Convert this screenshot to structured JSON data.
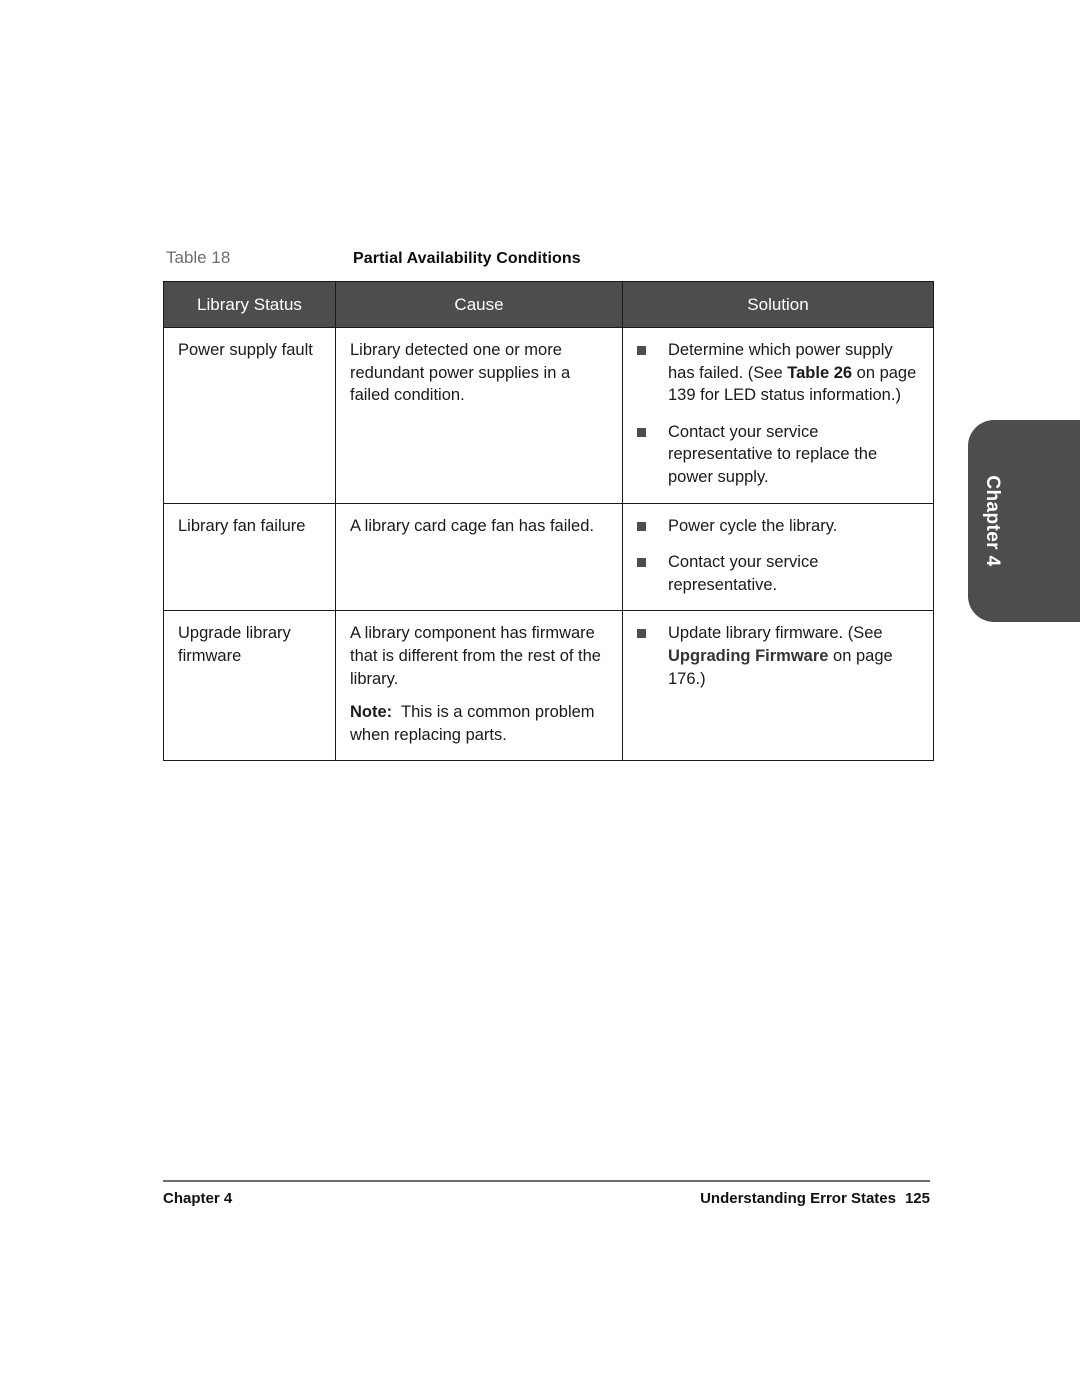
{
  "caption": {
    "label": "Table 18",
    "title": "Partial Availability Conditions"
  },
  "table": {
    "headers": {
      "status": "Library Status",
      "cause": "Cause",
      "solution": "Solution"
    },
    "rows": [
      {
        "status": "Power supply fault",
        "cause": "Library detected one or more redundant power supplies in a failed condition.",
        "solution": [
          {
            "prefix": "Determine which power supply has failed. (See ",
            "bold": "Table 26",
            "suffix": " on page 139 for LED status information.)"
          },
          {
            "prefix": "Contact your service representative to replace the power supply.",
            "bold": "",
            "suffix": ""
          }
        ]
      },
      {
        "status": "Library fan failure",
        "cause": "A library card cage fan has failed.",
        "solution": [
          {
            "prefix": "Power cycle the library.",
            "bold": "",
            "suffix": ""
          },
          {
            "prefix": "Contact your service representative.",
            "bold": "",
            "suffix": ""
          }
        ]
      },
      {
        "status": "Upgrade library firmware",
        "cause": "A library component has firmware that is different from the rest of the library.",
        "cause_note_label": "Note:",
        "cause_note_text": "This is a common problem when replacing parts.",
        "solution": [
          {
            "prefix": "Update library firmware. (See ",
            "bold": "Upgrading Firmware",
            "suffix": " on page 176.)"
          }
        ]
      }
    ]
  },
  "side_tab": {
    "label": "Chapter 4"
  },
  "footer": {
    "left": "Chapter 4",
    "right_title": "Understanding Error States",
    "page_number": "125"
  },
  "colors": {
    "header_bg": "#4d4d4d",
    "caption_label": "#6e6e6e",
    "bullet": "#4d4d4d",
    "text": "#1a1a1a"
  }
}
